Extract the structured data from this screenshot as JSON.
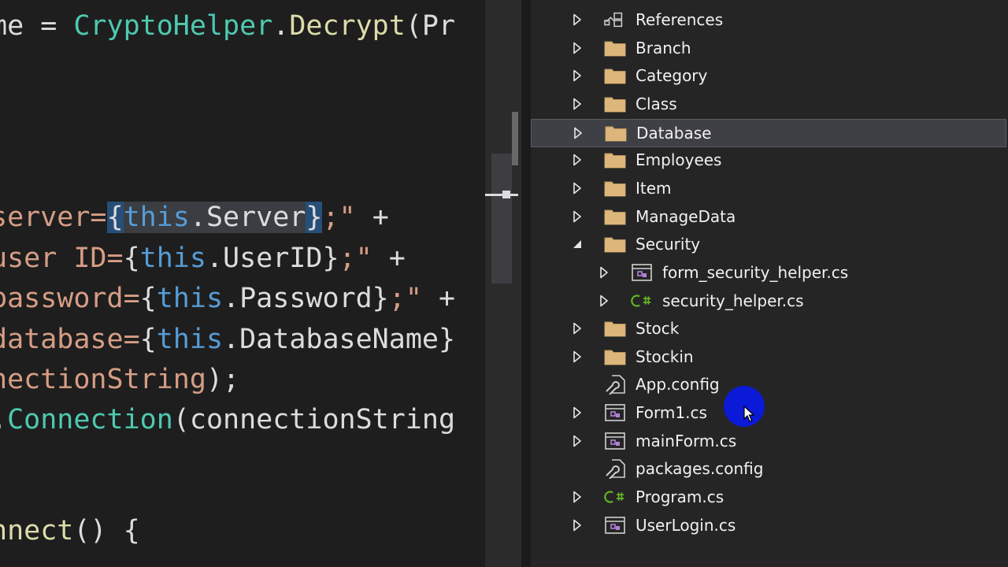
{
  "editor": {
    "lines": [
      [
        {
          "t": "me = ",
          "c": "plain"
        },
        {
          "t": "CryptoHelper",
          "c": "type"
        },
        {
          "t": ".",
          "c": "plain"
        },
        {
          "t": "Decrypt",
          "c": "method"
        },
        {
          "t": "(Pr",
          "c": "plain"
        }
      ],
      [
        {
          "t": "server=",
          "c": "str"
        },
        {
          "t": "{",
          "c": "plain",
          "hl": "sel"
        },
        {
          "t": "this",
          "c": "key",
          "hl": "hl"
        },
        {
          "t": ".",
          "c": "plain",
          "hl": "hl"
        },
        {
          "t": "Server",
          "c": "prop",
          "hl": "hl"
        },
        {
          "t": "}",
          "c": "plain",
          "hl": "sel"
        },
        {
          "t": ";\" ",
          "c": "str"
        },
        {
          "t": "+",
          "c": "plain"
        }
      ],
      [
        {
          "t": "user ID=",
          "c": "str"
        },
        {
          "t": "{",
          "c": "plain"
        },
        {
          "t": "this",
          "c": "key"
        },
        {
          "t": ".UserID}",
          "c": "plain"
        },
        {
          "t": ";\" ",
          "c": "str"
        },
        {
          "t": "+",
          "c": "plain"
        }
      ],
      [
        {
          "t": "password=",
          "c": "str"
        },
        {
          "t": "{",
          "c": "plain"
        },
        {
          "t": "this",
          "c": "key"
        },
        {
          "t": ".Password}",
          "c": "plain"
        },
        {
          "t": ";\" ",
          "c": "str"
        },
        {
          "t": "+",
          "c": "plain"
        }
      ],
      [
        {
          "t": "database=",
          "c": "str"
        },
        {
          "t": "{",
          "c": "plain"
        },
        {
          "t": "this",
          "c": "key"
        },
        {
          "t": ".DatabaseName}",
          "c": "plain"
        }
      ],
      [
        {
          "t": "nectionString",
          "c": "str"
        },
        {
          "t": ");",
          "c": "plain"
        }
      ],
      [
        {
          "t": ".",
          "c": "plain"
        },
        {
          "t": "Connection",
          "c": "type"
        },
        {
          "t": "(connectionString",
          "c": "plain"
        }
      ],
      [
        {
          "t": "nnect",
          "c": "method"
        },
        {
          "t": "() {",
          "c": "plain"
        }
      ]
    ]
  },
  "explorer": {
    "items": [
      {
        "label": "References",
        "icon": "references-icon",
        "expander": "collapsed",
        "indent": 0
      },
      {
        "label": "Branch",
        "icon": "folder-icon",
        "expander": "collapsed",
        "indent": 0
      },
      {
        "label": "Category",
        "icon": "folder-icon",
        "expander": "collapsed",
        "indent": 0
      },
      {
        "label": "Class",
        "icon": "folder-icon",
        "expander": "collapsed",
        "indent": 0
      },
      {
        "label": "Database",
        "icon": "folder-icon",
        "expander": "collapsed",
        "indent": 0,
        "selected": true
      },
      {
        "label": "Employees",
        "icon": "folder-icon",
        "expander": "collapsed",
        "indent": 0
      },
      {
        "label": "Item",
        "icon": "folder-icon",
        "expander": "collapsed",
        "indent": 0
      },
      {
        "label": "ManageData",
        "icon": "folder-icon",
        "expander": "collapsed",
        "indent": 0
      },
      {
        "label": "Security",
        "icon": "folder-open-icon",
        "expander": "expanded",
        "indent": 0
      },
      {
        "label": "form_security_helper.cs",
        "icon": "form-icon",
        "expander": "collapsed",
        "indent": 1
      },
      {
        "label": "security_helper.cs",
        "icon": "csharp-icon",
        "expander": "collapsed",
        "indent": 1
      },
      {
        "label": "Stock",
        "icon": "folder-icon",
        "expander": "collapsed",
        "indent": 0
      },
      {
        "label": "Stockin",
        "icon": "folder-icon",
        "expander": "collapsed",
        "indent": 0
      },
      {
        "label": "App.config",
        "icon": "config-icon",
        "expander": "none",
        "indent": 0
      },
      {
        "label": "Form1.cs",
        "icon": "form-icon",
        "expander": "collapsed",
        "indent": 0
      },
      {
        "label": "mainForm.cs",
        "icon": "form-icon",
        "expander": "collapsed",
        "indent": 0
      },
      {
        "label": "packages.config",
        "icon": "config-icon",
        "expander": "none",
        "indent": 0
      },
      {
        "label": "Program.cs",
        "icon": "csharp-icon",
        "expander": "collapsed",
        "indent": 0
      },
      {
        "label": "UserLogin.cs",
        "icon": "form-icon",
        "expander": "collapsed",
        "indent": 0
      }
    ]
  },
  "colors": {
    "folder": "#dcb67a",
    "csharp": "#68b723",
    "form_accent": "#b180d7",
    "cursor_halo": "#0a1ad6"
  }
}
